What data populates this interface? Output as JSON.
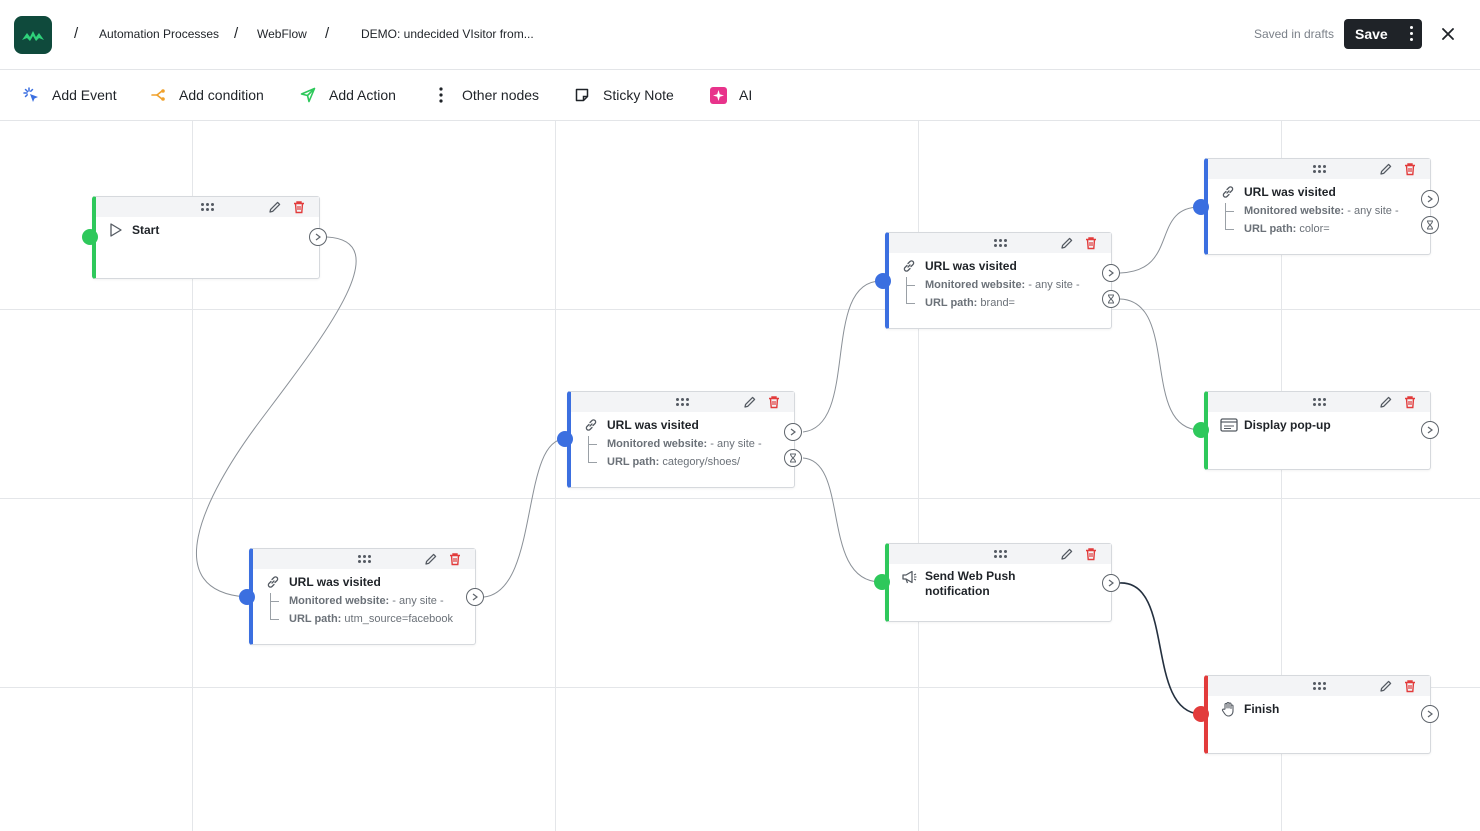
{
  "header": {
    "breadcrumbs": [
      "Automation Processes",
      "WebFlow",
      "DEMO: undecided VIsitor from..."
    ],
    "saved_status": "Saved in drafts",
    "save_label": "Save",
    "close_icon": "close-icon",
    "logo_icon": "app-logo"
  },
  "toolbar": {
    "items": [
      {
        "label": "Add Event",
        "icon": "sparkle-click-icon",
        "color": "#3b6fe0"
      },
      {
        "label": "Add condition",
        "icon": "branch-icon",
        "color": "#f0a12b"
      },
      {
        "label": "Add Action",
        "icon": "send-icon",
        "color": "#2ec85b"
      },
      {
        "label": "Other nodes",
        "icon": "kebab-icon",
        "color": "#1f2328"
      },
      {
        "label": "Sticky Note",
        "icon": "sticky-note-icon",
        "color": "#1f2328"
      },
      {
        "label": "AI",
        "icon": "ai-sparkle-icon",
        "color": "#e8338b"
      }
    ]
  },
  "colors": {
    "event": "#3b6fe0",
    "action": "#2ec85b",
    "finish": "#e23b3b",
    "delete": "#e23b3b"
  },
  "nodes": {
    "start": {
      "title": "Start",
      "icon": "play-icon"
    },
    "url1": {
      "title": "URL was visited",
      "icon": "link-icon",
      "website_label": "Monitored website:",
      "website_value": "- any site -",
      "path_label": "URL path:",
      "path_value": "utm_source=facebook"
    },
    "url2": {
      "title": "URL was visited",
      "icon": "link-icon",
      "website_label": "Monitored website:",
      "website_value": "- any site -",
      "path_label": "URL path:",
      "path_value": "category/shoes/"
    },
    "url3": {
      "title": "URL was visited",
      "icon": "link-icon",
      "website_label": "Monitored website:",
      "website_value": "- any site -",
      "path_label": "URL path:",
      "path_value": "brand="
    },
    "url4": {
      "title": "URL was visited",
      "icon": "link-icon",
      "website_label": "Monitored website:",
      "website_value": "- any site -",
      "path_label": "URL path:",
      "path_value": "color="
    },
    "popup": {
      "title": "Display pop-up",
      "icon": "popup-window-icon"
    },
    "push": {
      "title_line1": "Send Web Push",
      "title_line2": "notification",
      "icon": "megaphone-icon"
    },
    "finish": {
      "title": "Finish",
      "icon": "hand-stop-icon"
    }
  }
}
